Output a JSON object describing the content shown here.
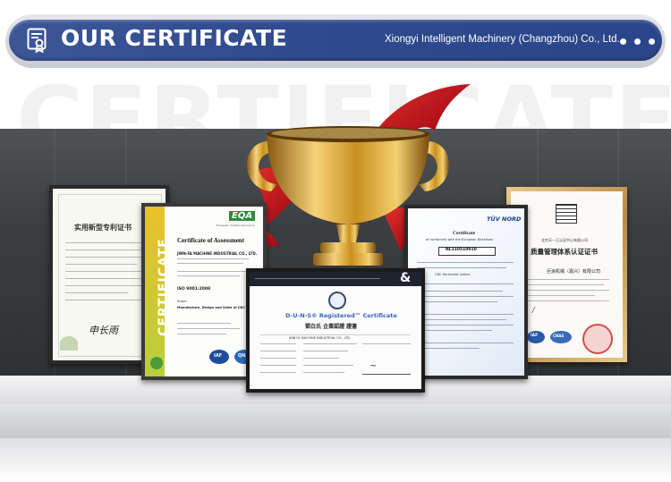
{
  "header": {
    "title": "OUR CERTIFICATE",
    "company": "Xiongyi Intelligent Machinery (Changzhou) Co., Ltd.",
    "icon": "certificate-icon"
  },
  "background_word": "CERTIFICATE",
  "colors": {
    "banner": "#2f4a8e",
    "ribbon": "#c8191b",
    "gold": "#d9a53a"
  },
  "certificates": {
    "patent": {
      "title": "实用新型专利证书",
      "signature": "申长雨"
    },
    "assessment": {
      "side_label": "CERTIFICATE",
      "logo": "EQA",
      "logo_sub": "European Quality Assurance",
      "title": "Certificate of Assessment",
      "company": "JINN-FA MACHINE INDUSTRIAL CO., LTD.",
      "standard": "ISO 9001:2008",
      "scope_label": "Scope",
      "scope": "Manufacture, Design and Sales of CNC Machine",
      "seal1": "IAF",
      "seal2": "QNA"
    },
    "duns": {
      "title": "D-U-N-S® Registered™ Certificate",
      "title_cn": "鄧白氏 企業認證 證書",
      "company": "JINN FA MACHINE INDUSTRIAL CO., LTD."
    },
    "tuv": {
      "brand": "TÜV NORD",
      "title": "Certificate",
      "subtitle": "of conformity with the European Directives",
      "number": "NL110510010",
      "product": "CNC Horizontal Lathes"
    },
    "quality": {
      "org": "北京天一正认证中心有限公司",
      "title": "质量管理体系认证证书",
      "company": "巨浪机械（嘉兴）有限公司",
      "seal1": "IAF",
      "seal2": "CNAS"
    }
  }
}
